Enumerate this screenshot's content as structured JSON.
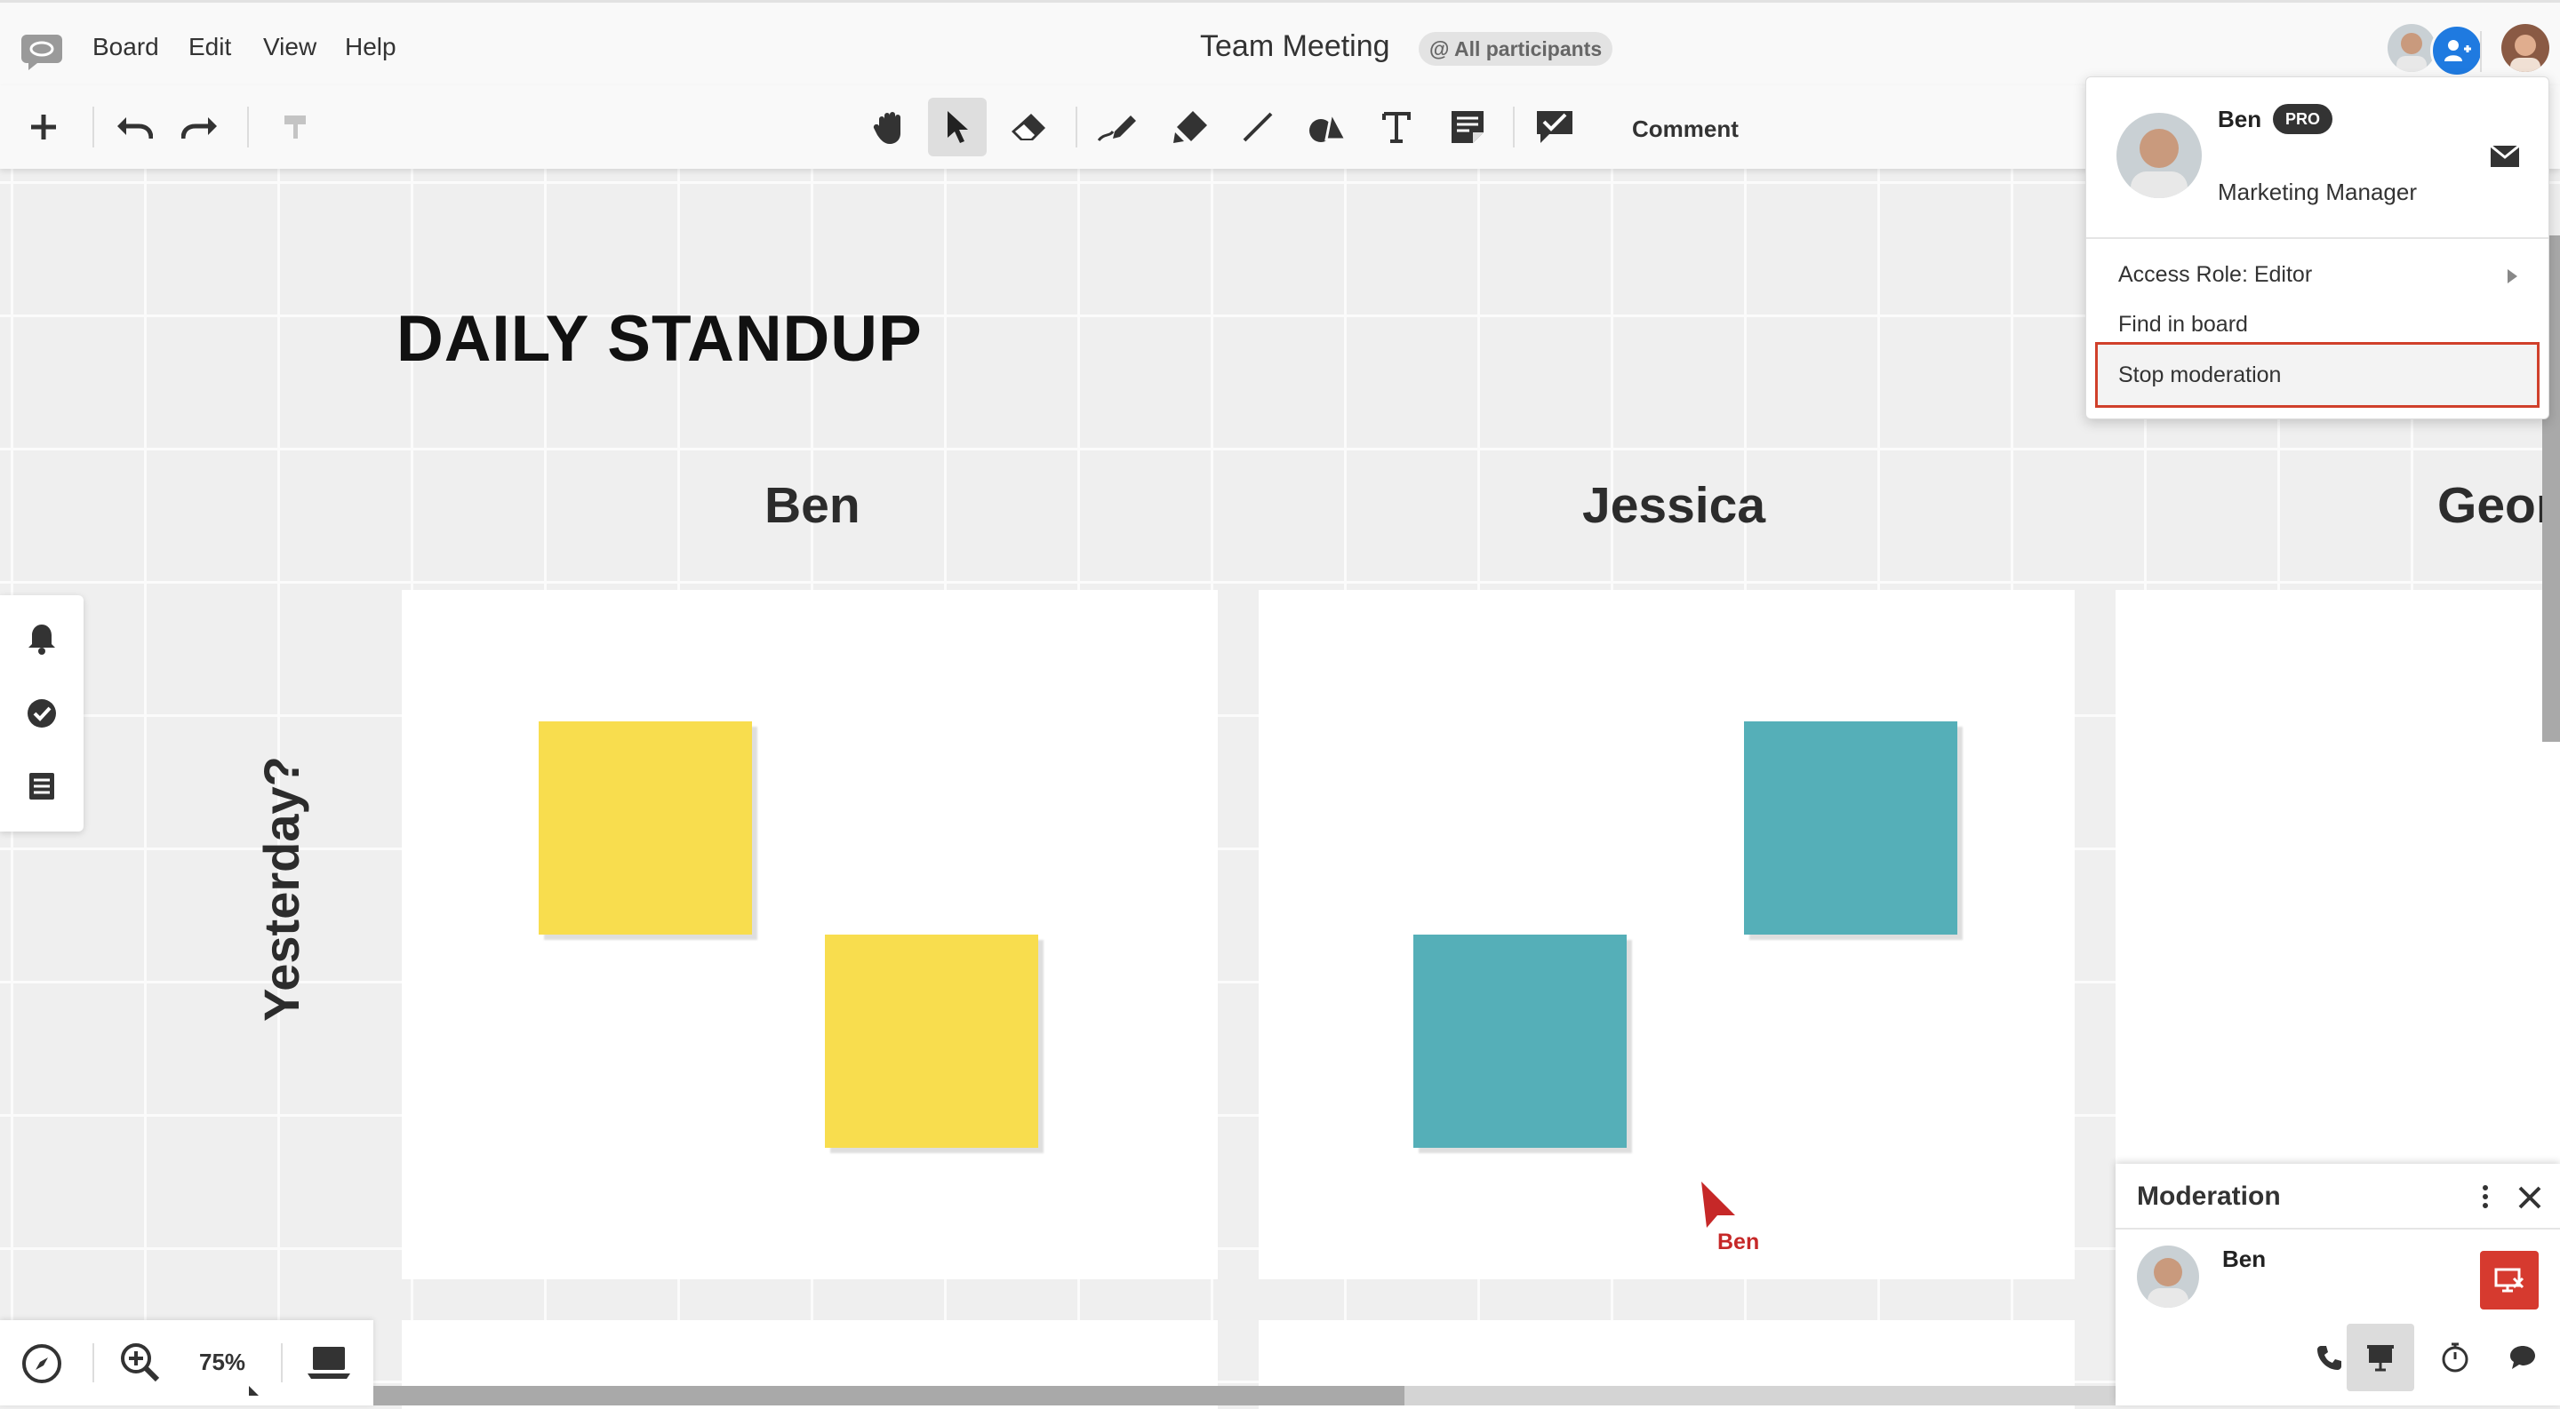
{
  "menu": {
    "items": [
      {
        "label": "Board"
      },
      {
        "label": "Edit"
      },
      {
        "label": "View"
      },
      {
        "label": "Help"
      }
    ],
    "board_title": "Team Meeting",
    "participants_pill": "@ All participants"
  },
  "toolbar": {
    "tools": [
      "add-icon",
      "undo-icon",
      "redo-icon",
      "format-painter-icon",
      "hand-icon",
      "select-icon",
      "eraser-icon",
      "pen-icon",
      "highlighter-icon",
      "line-icon",
      "shapes-icon",
      "text-icon",
      "sticky-note-icon",
      "comment-icon"
    ],
    "active_tool": "select-icon",
    "comment_label": "Comment"
  },
  "board": {
    "title": "DAILY STANDUP",
    "columns": [
      {
        "label": "Ben"
      },
      {
        "label": "Jessica"
      },
      {
        "label": "Geor"
      }
    ],
    "row_label": "Yesterday?",
    "sticky_colors": {
      "yellow": "#f8dd4e",
      "teal": "#55afb8"
    },
    "cursor": {
      "label": "Ben",
      "color": "#c62828"
    }
  },
  "side_panel": {
    "buttons": [
      "bell-icon",
      "check-circle-icon",
      "list-icon"
    ]
  },
  "bottom_nav": {
    "zoom": "75%",
    "buttons": [
      "compass-icon",
      "zoom-in-icon",
      "laptop-icon"
    ]
  },
  "user_popup": {
    "name": "Ben",
    "badge": "PRO",
    "role": "Marketing Manager",
    "items": [
      {
        "label": "Access Role: Editor"
      },
      {
        "label": "Find in board"
      },
      {
        "label": "Stop moderation"
      }
    ],
    "highlight_color": "#d0402b"
  },
  "moderation": {
    "title": "Moderation",
    "user": "Ben",
    "controls": [
      "phone-icon",
      "presentation-icon",
      "timer-icon",
      "chat-icon"
    ]
  }
}
